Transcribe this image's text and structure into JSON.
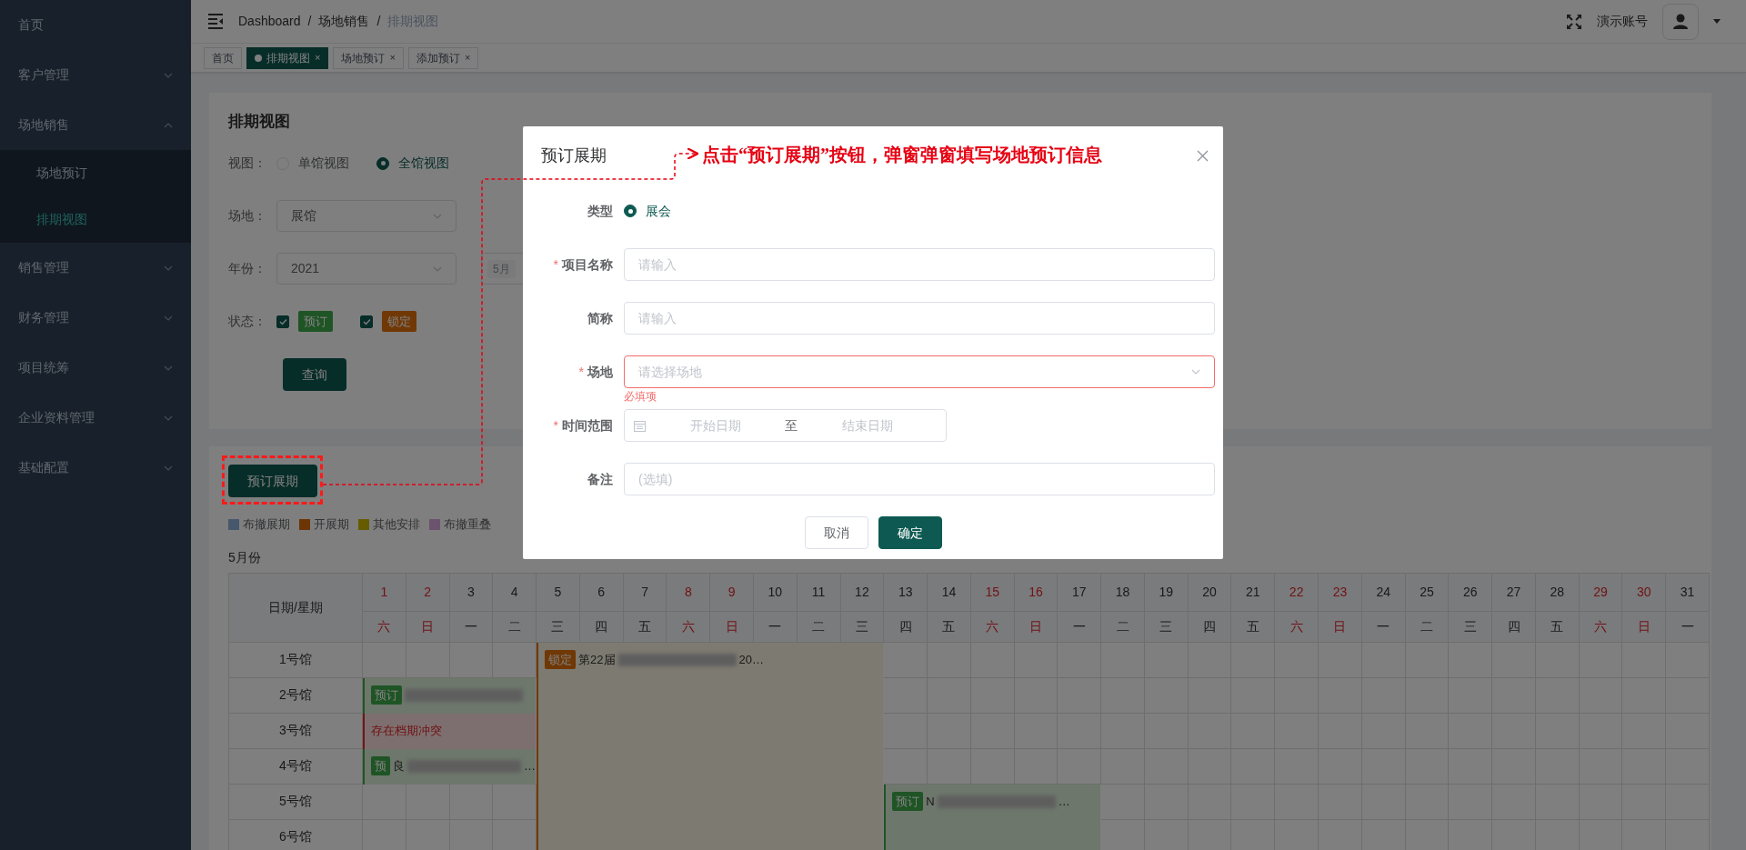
{
  "sidebar": {
    "items": [
      {
        "label": "首页",
        "kind": "link",
        "selected": false
      },
      {
        "label": "客户管理",
        "kind": "group",
        "expanded": false,
        "selected": false
      },
      {
        "label": "场地销售",
        "kind": "group",
        "expanded": true,
        "selected": false,
        "children": [
          {
            "label": "场地预订",
            "selected": false
          },
          {
            "label": "排期视图",
            "selected": true
          }
        ]
      },
      {
        "label": "销售管理",
        "kind": "group",
        "expanded": false,
        "selected": false
      },
      {
        "label": "财务管理",
        "kind": "group",
        "expanded": false,
        "selected": false
      },
      {
        "label": "项目统筹",
        "kind": "group",
        "expanded": false,
        "selected": false
      },
      {
        "label": "企业资料管理",
        "kind": "group",
        "expanded": false,
        "selected": false
      },
      {
        "label": "基础配置",
        "kind": "group",
        "expanded": false,
        "selected": false
      }
    ]
  },
  "header": {
    "breadcrumb": [
      "Dashboard",
      "场地销售",
      "排期视图"
    ],
    "separator": "/",
    "user": "演示账号"
  },
  "tabs": [
    {
      "label": "首页",
      "selected": false
    },
    {
      "label": "排期视图",
      "selected": true,
      "close": "×"
    },
    {
      "label": "场地预订",
      "selected": false,
      "close": "×"
    },
    {
      "label": "添加预订",
      "selected": false,
      "close": "×"
    }
  ],
  "filter_panel": {
    "title": "排期视图",
    "view": {
      "label": "视图：",
      "options": [
        {
          "label": "单馆视图",
          "selected": false
        },
        {
          "label": "全馆视图",
          "selected": true
        }
      ]
    },
    "venue": {
      "label": "场地：",
      "value": "展馆"
    },
    "year": {
      "label": "年份：",
      "value": "2021",
      "months": [
        "5月"
      ]
    },
    "status": {
      "label": "状态：",
      "options": [
        {
          "label": "预订",
          "checked": true,
          "kind": "booking"
        },
        {
          "label": "锁定",
          "checked": true,
          "kind": "locked"
        }
      ]
    },
    "query_button": "查询"
  },
  "schedule": {
    "book_button": "预订展期",
    "legend": [
      {
        "label": "布撤展期",
        "kind": "setup"
      },
      {
        "label": "开展期",
        "kind": "open"
      },
      {
        "label": "其他安排",
        "kind": "other"
      },
      {
        "label": "布撤重叠",
        "kind": "overlap"
      }
    ],
    "month": "5月份",
    "corner": "日期/星期",
    "days": [
      {
        "day": "1",
        "weekday": "六",
        "weekend": true
      },
      {
        "day": "2",
        "weekday": "日",
        "weekend": true
      },
      {
        "day": "3",
        "weekday": "一",
        "weekend": false
      },
      {
        "day": "4",
        "weekday": "二",
        "weekend": false
      },
      {
        "day": "5",
        "weekday": "三",
        "weekend": false
      },
      {
        "day": "6",
        "weekday": "四",
        "weekend": false
      },
      {
        "day": "7",
        "weekday": "五",
        "weekend": false
      },
      {
        "day": "8",
        "weekday": "六",
        "weekend": true
      },
      {
        "day": "9",
        "weekday": "日",
        "weekend": true
      },
      {
        "day": "10",
        "weekday": "一",
        "weekend": false
      },
      {
        "day": "11",
        "weekday": "二",
        "weekend": false
      },
      {
        "day": "12",
        "weekday": "三",
        "weekend": false
      },
      {
        "day": "13",
        "weekday": "四",
        "weekend": false
      },
      {
        "day": "14",
        "weekday": "五",
        "weekend": false
      },
      {
        "day": "15",
        "weekday": "六",
        "weekend": true
      },
      {
        "day": "16",
        "weekday": "日",
        "weekend": true
      },
      {
        "day": "17",
        "weekday": "一",
        "weekend": false
      },
      {
        "day": "18",
        "weekday": "二",
        "weekend": false
      },
      {
        "day": "19",
        "weekday": "三",
        "weekend": false
      },
      {
        "day": "20",
        "weekday": "四",
        "weekend": false
      },
      {
        "day": "21",
        "weekday": "五",
        "weekend": false
      },
      {
        "day": "22",
        "weekday": "六",
        "weekend": true
      },
      {
        "day": "23",
        "weekday": "日",
        "weekend": true
      },
      {
        "day": "24",
        "weekday": "一",
        "weekend": false
      },
      {
        "day": "25",
        "weekday": "二",
        "weekend": false
      },
      {
        "day": "26",
        "weekday": "三",
        "weekend": false
      },
      {
        "day": "27",
        "weekday": "四",
        "weekend": false
      },
      {
        "day": "28",
        "weekday": "五",
        "weekend": false
      },
      {
        "day": "29",
        "weekday": "六",
        "weekend": true
      },
      {
        "day": "30",
        "weekday": "日",
        "weekend": true
      },
      {
        "day": "31",
        "weekday": "一",
        "weekend": false
      }
    ],
    "halls": [
      {
        "name": "1号馆",
        "cells": [
          {
            "kind": "empty"
          },
          {
            "kind": "empty"
          },
          {
            "kind": "empty"
          },
          {
            "kind": "empty"
          },
          {
            "kind": "locked",
            "tag": "锁定",
            "text": "第22届",
            "tail": "20…"
          },
          {
            "kind": "continue_left"
          },
          {
            "kind": "continue_left"
          },
          {
            "kind": "continue_left"
          },
          {
            "kind": "continue_left"
          },
          {
            "kind": "continue_left"
          },
          {
            "kind": "continue_left"
          },
          {
            "kind": "continue_left"
          },
          {
            "kind": "empty"
          },
          {
            "kind": "empty"
          },
          {
            "kind": "empty"
          },
          {
            "kind": "empty"
          },
          {
            "kind": "empty"
          },
          {
            "kind": "empty"
          },
          {
            "kind": "empty"
          },
          {
            "kind": "empty"
          },
          {
            "kind": "empty"
          },
          {
            "kind": "empty"
          },
          {
            "kind": "empty"
          },
          {
            "kind": "empty"
          },
          {
            "kind": "empty"
          },
          {
            "kind": "empty"
          },
          {
            "kind": "empty"
          },
          {
            "kind": "empty"
          },
          {
            "kind": "empty"
          },
          {
            "kind": "empty"
          },
          {
            "kind": "empty"
          }
        ]
      },
      {
        "name": "2号馆",
        "cells": [
          {
            "kind": "booking",
            "tag": "预订"
          },
          {
            "kind": "continue_left"
          },
          {
            "kind": "continue_left"
          },
          {
            "kind": "continue_left"
          },
          {
            "kind": "continue_above"
          },
          {
            "kind": "continue_left"
          },
          {
            "kind": "continue_left"
          },
          {
            "kind": "continue_left"
          },
          {
            "kind": "continue_left"
          },
          {
            "kind": "continue_left"
          },
          {
            "kind": "continue_left"
          },
          {
            "kind": "continue_left"
          },
          {
            "kind": "empty"
          },
          {
            "kind": "empty"
          },
          {
            "kind": "empty"
          },
          {
            "kind": "empty"
          },
          {
            "kind": "empty"
          },
          {
            "kind": "empty"
          },
          {
            "kind": "empty"
          },
          {
            "kind": "empty"
          },
          {
            "kind": "empty"
          },
          {
            "kind": "empty"
          },
          {
            "kind": "empty"
          },
          {
            "kind": "empty"
          },
          {
            "kind": "empty"
          },
          {
            "kind": "empty"
          },
          {
            "kind": "empty"
          },
          {
            "kind": "empty"
          },
          {
            "kind": "empty"
          },
          {
            "kind": "empty"
          },
          {
            "kind": "empty"
          }
        ]
      },
      {
        "name": "3号馆",
        "cells": [
          {
            "kind": "conflict",
            "text": "存在档期冲突"
          },
          {
            "kind": "continue_left"
          },
          {
            "kind": "continue_left"
          },
          {
            "kind": "continue_left"
          },
          {
            "kind": "continue_above"
          },
          {
            "kind": "continue_left"
          },
          {
            "kind": "continue_left"
          },
          {
            "kind": "continue_left"
          },
          {
            "kind": "continue_left"
          },
          {
            "kind": "continue_left"
          },
          {
            "kind": "continue_left"
          },
          {
            "kind": "continue_left"
          },
          {
            "kind": "empty"
          },
          {
            "kind": "empty"
          },
          {
            "kind": "empty"
          },
          {
            "kind": "empty"
          },
          {
            "kind": "empty"
          },
          {
            "kind": "empty"
          },
          {
            "kind": "empty"
          },
          {
            "kind": "empty"
          },
          {
            "kind": "empty"
          },
          {
            "kind": "empty"
          },
          {
            "kind": "empty"
          },
          {
            "kind": "empty"
          },
          {
            "kind": "empty"
          },
          {
            "kind": "empty"
          },
          {
            "kind": "empty"
          },
          {
            "kind": "empty"
          },
          {
            "kind": "empty"
          },
          {
            "kind": "empty"
          },
          {
            "kind": "empty"
          }
        ]
      },
      {
        "name": "4号馆",
        "cells": [
          {
            "kind": "booking",
            "tag": "预",
            "text": "良",
            "tail": "…"
          },
          {
            "kind": "continue_left"
          },
          {
            "kind": "continue_left"
          },
          {
            "kind": "continue_left"
          },
          {
            "kind": "continue_above"
          },
          {
            "kind": "continue_left"
          },
          {
            "kind": "continue_left"
          },
          {
            "kind": "continue_left"
          },
          {
            "kind": "continue_left"
          },
          {
            "kind": "continue_left"
          },
          {
            "kind": "continue_left"
          },
          {
            "kind": "continue_left"
          },
          {
            "kind": "empty"
          },
          {
            "kind": "empty"
          },
          {
            "kind": "empty"
          },
          {
            "kind": "empty"
          },
          {
            "kind": "empty"
          },
          {
            "kind": "empty"
          },
          {
            "kind": "empty"
          },
          {
            "kind": "empty"
          },
          {
            "kind": "empty"
          },
          {
            "kind": "empty"
          },
          {
            "kind": "empty"
          },
          {
            "kind": "empty"
          },
          {
            "kind": "empty"
          },
          {
            "kind": "empty"
          },
          {
            "kind": "empty"
          },
          {
            "kind": "empty"
          },
          {
            "kind": "empty"
          },
          {
            "kind": "empty"
          },
          {
            "kind": "empty"
          }
        ]
      },
      {
        "name": "5号馆",
        "cells": [
          {
            "kind": "empty"
          },
          {
            "kind": "empty"
          },
          {
            "kind": "empty"
          },
          {
            "kind": "empty"
          },
          {
            "kind": "continue_above"
          },
          {
            "kind": "continue_left"
          },
          {
            "kind": "continue_left"
          },
          {
            "kind": "continue_left"
          },
          {
            "kind": "continue_left"
          },
          {
            "kind": "continue_left"
          },
          {
            "kind": "continue_left"
          },
          {
            "kind": "continue_left"
          },
          {
            "kind": "booking",
            "tag": "预订",
            "text": "N",
            "tail": "…"
          },
          {
            "kind": "continue_left"
          },
          {
            "kind": "continue_left"
          },
          {
            "kind": "continue_left"
          },
          {
            "kind": "continue_left"
          },
          {
            "kind": "empty"
          },
          {
            "kind": "empty"
          },
          {
            "kind": "empty"
          },
          {
            "kind": "empty"
          },
          {
            "kind": "empty"
          },
          {
            "kind": "empty"
          },
          {
            "kind": "empty"
          },
          {
            "kind": "empty"
          },
          {
            "kind": "empty"
          },
          {
            "kind": "empty"
          },
          {
            "kind": "empty"
          },
          {
            "kind": "empty"
          },
          {
            "kind": "empty"
          },
          {
            "kind": "empty"
          }
        ]
      },
      {
        "name": "6号馆",
        "cells": [
          {
            "kind": "empty"
          },
          {
            "kind": "empty"
          },
          {
            "kind": "empty"
          },
          {
            "kind": "empty"
          },
          {
            "kind": "continue_above"
          },
          {
            "kind": "continue_left"
          },
          {
            "kind": "continue_left"
          },
          {
            "kind": "continue_left"
          },
          {
            "kind": "continue_left"
          },
          {
            "kind": "continue_left"
          },
          {
            "kind": "continue_left"
          },
          {
            "kind": "continue_left"
          },
          {
            "kind": "continue_above"
          },
          {
            "kind": "continue_left"
          },
          {
            "kind": "continue_left"
          },
          {
            "kind": "continue_left"
          },
          {
            "kind": "continue_left"
          },
          {
            "kind": "empty"
          },
          {
            "kind": "empty"
          },
          {
            "kind": "empty"
          },
          {
            "kind": "empty"
          },
          {
            "kind": "empty"
          },
          {
            "kind": "empty"
          },
          {
            "kind": "empty"
          },
          {
            "kind": "empty"
          },
          {
            "kind": "empty"
          },
          {
            "kind": "empty"
          },
          {
            "kind": "empty"
          },
          {
            "kind": "empty"
          },
          {
            "kind": "empty"
          },
          {
            "kind": "empty"
          }
        ]
      }
    ]
  },
  "dialog": {
    "title": "预订展期",
    "required_mark": "*",
    "type": {
      "label": "类型",
      "options": [
        {
          "label": "展会",
          "selected": true
        }
      ]
    },
    "fields": [
      {
        "kind": "input",
        "label": "项目名称",
        "required": true,
        "placeholder": "请输入"
      },
      {
        "kind": "input",
        "label": "简称",
        "required": false,
        "placeholder": "请输入"
      },
      {
        "kind": "select",
        "label": "场地",
        "required": true,
        "placeholder": "请选择场地",
        "error": "必填项"
      },
      {
        "kind": "daterange",
        "label": "时间范围",
        "required": true,
        "start_placeholder": "开始日期",
        "separator": "至",
        "end_placeholder": "结束日期"
      },
      {
        "kind": "input",
        "label": "备注",
        "required": false,
        "placeholder": "(选填)"
      }
    ],
    "buttons": [
      {
        "label": "取消",
        "primary": false
      },
      {
        "label": "确定",
        "primary": true
      }
    ]
  },
  "annotation": {
    "text": "点击“预订展期”按钮，弹窗弹窗填写场地预订信息"
  }
}
